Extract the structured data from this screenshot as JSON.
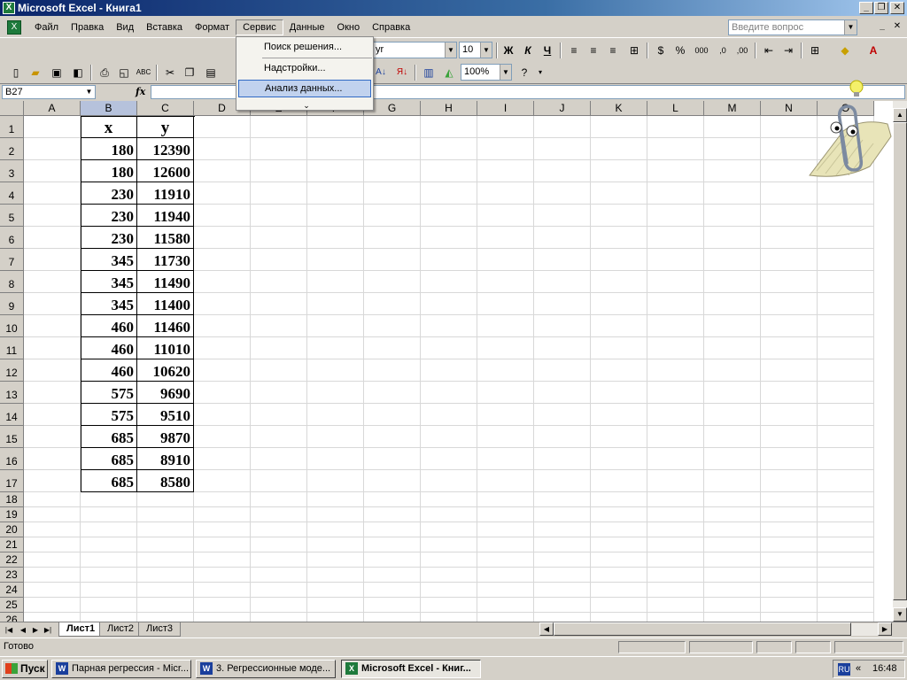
{
  "window": {
    "title": "Microsoft Excel - Книга1"
  },
  "menubar": {
    "items": [
      "Файл",
      "Правка",
      "Вид",
      "Вставка",
      "Формат",
      "Сервис",
      "Данные",
      "Окно",
      "Справка"
    ],
    "open_item": "Сервис",
    "ask_placeholder": "Введите вопрос"
  },
  "service_menu": {
    "items": [
      "Поиск решения...",
      "Надстройки...",
      "Анализ данных..."
    ],
    "highlighted": "Анализ данных...",
    "expand_glyph": "⌄"
  },
  "toolbar": {
    "font_name": "yr",
    "font_size": "10",
    "zoom": "100%",
    "bold": "Ж",
    "italic": "К",
    "underline": "Ч"
  },
  "formula_bar": {
    "name_box": "B27",
    "fx": "fx",
    "formula": ""
  },
  "grid": {
    "columns": [
      "A",
      "B",
      "C",
      "D",
      "E",
      "F",
      "G",
      "H",
      "I",
      "J",
      "K",
      "L",
      "M",
      "N",
      "O"
    ],
    "rows": [
      "1",
      "2",
      "3",
      "4",
      "5",
      "6",
      "7",
      "8",
      "9",
      "10",
      "11",
      "12",
      "13",
      "14",
      "15",
      "16",
      "17",
      "18",
      "19",
      "20",
      "21",
      "22",
      "23",
      "24",
      "25",
      "26"
    ],
    "selected_column": "B",
    "headers": [
      "x",
      "y"
    ],
    "data": [
      [
        "180",
        "12390"
      ],
      [
        "180",
        "12600"
      ],
      [
        "230",
        "11910"
      ],
      [
        "230",
        "11940"
      ],
      [
        "230",
        "11580"
      ],
      [
        "345",
        "11730"
      ],
      [
        "345",
        "11490"
      ],
      [
        "345",
        "11400"
      ],
      [
        "460",
        "11460"
      ],
      [
        "460",
        "11010"
      ],
      [
        "460",
        "10620"
      ],
      [
        "575",
        "9690"
      ],
      [
        "575",
        "9510"
      ],
      [
        "685",
        "9870"
      ],
      [
        "685",
        "8910"
      ],
      [
        "685",
        "8580"
      ]
    ]
  },
  "sheets": {
    "tabs": [
      "Лист1",
      "Лист2",
      "Лист3"
    ],
    "active": "Лист1"
  },
  "status": {
    "text": "Готово"
  },
  "taskbar": {
    "start": "Пуск",
    "buttons": [
      "Парная регрессия - Micr...",
      "3. Регрессионные моде...",
      "Microsoft Excel - Книг..."
    ],
    "active_button": "Microsoft Excel - Книг...",
    "lang": "RU",
    "time": "16:48"
  }
}
